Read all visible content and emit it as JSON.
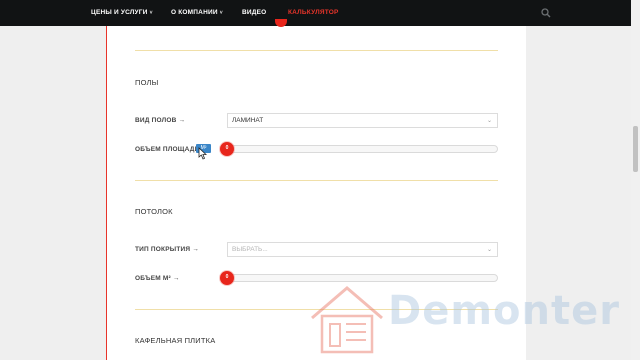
{
  "nav": {
    "items": [
      {
        "label": "ЦЕНЫ И УСЛУГИ",
        "chevron": "˅"
      },
      {
        "label": "О КОМПАНИИ",
        "chevron": "˅"
      },
      {
        "label": "ВИДЕО",
        "chevron": ""
      },
      {
        "label": "КАЛЬКУЛЯТОР",
        "chevron": ""
      }
    ],
    "active_color": "#e8342a",
    "search_icon": "search-icon"
  },
  "sections": {
    "floors": {
      "title": "ПОЛЫ",
      "type_label": "ВИД ПОЛОВ →",
      "type_value": "ЛАМИНАТ",
      "area_label": "ОБЪЕМ ПЛОЩАДИ →",
      "area_value": "0",
      "tooltip": "М²"
    },
    "ceiling": {
      "title": "ПОТОЛОК",
      "type_label": "ТИП ПОКРЫТИЯ →",
      "type_placeholder": "ВЫБРАТЬ...",
      "volume_label": "ОБЪЕМ М² →",
      "volume_value": "0"
    },
    "tiles": {
      "title": "КАФЕЛЬНАЯ ПЛИТКА"
    }
  },
  "watermark": {
    "text": "Demonter",
    "logo_icon": "house-logo-icon"
  },
  "colors": {
    "accent": "#e8261c",
    "divider": "#f0dfa8",
    "topbar": "#111314",
    "watermark": "#a9c5de"
  }
}
